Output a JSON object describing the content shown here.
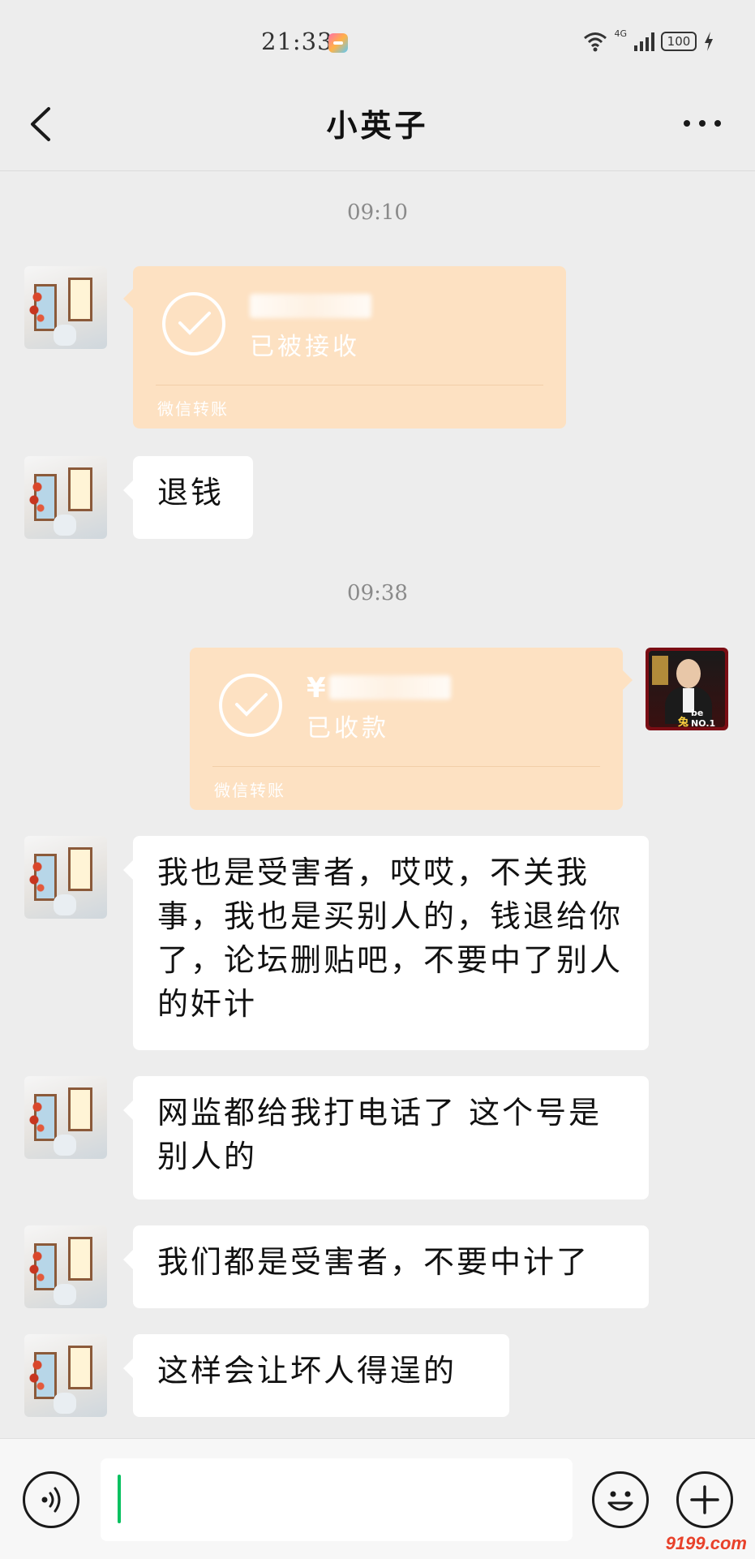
{
  "status_bar": {
    "time": "21:33",
    "network": "4G",
    "battery": "100",
    "icons": [
      "app-notification-icon",
      "wifi-icon",
      "signal-icon",
      "battery-icon",
      "charging-icon"
    ]
  },
  "header": {
    "title": "小英子",
    "back_icon": "chevron-left-icon",
    "more_icon": "more-dots-icon"
  },
  "messages": {
    "timestamp_1": "09:10",
    "transfer_received": {
      "status": "已被接收",
      "label": "微信转账"
    },
    "refund_text": "退钱",
    "timestamp_2": "09:38",
    "transfer_collected": {
      "amount_prefix": "¥",
      "status": "已收款",
      "label": "微信转账"
    },
    "text_1": "我也是受害者，哎哎，不关我事，我也是买别人的，钱退给你了，论坛删贴吧，不要中了别人的奸计",
    "text_2": "网监都给我打电话了 这个号是别人的",
    "text_3": "我们都是受害者，不要中计了",
    "text_4": "这样会让坏人得逞的"
  },
  "my_avatar": {
    "badge": "be NO.1",
    "badge_char": "兔"
  },
  "input_bar": {
    "text": "",
    "icons": [
      "voice-icon",
      "emoji-icon",
      "plus-icon"
    ]
  },
  "watermark": {
    "text": "9199",
    "suffix": ".com"
  },
  "colors": {
    "background": "#ededed",
    "bubble": "#ffffff",
    "transfer_card": "#fde1c2",
    "cursor": "#07c160"
  }
}
